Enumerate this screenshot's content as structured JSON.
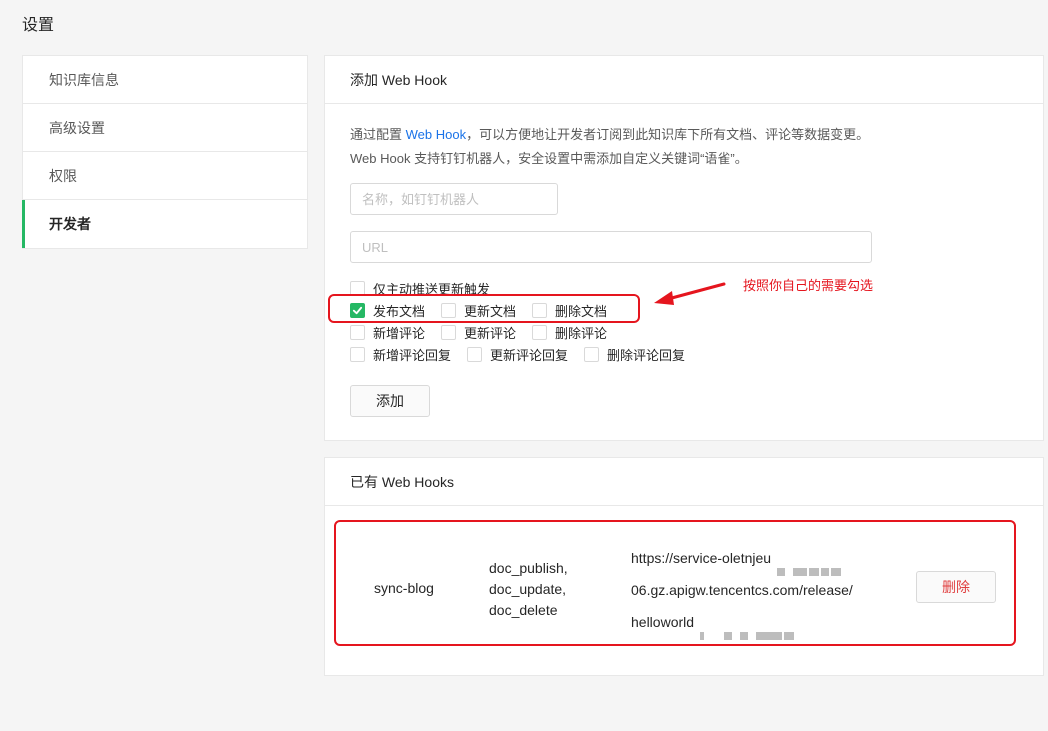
{
  "page": {
    "title": "设置"
  },
  "sidebar": {
    "items": [
      {
        "label": "知识库信息",
        "active": false
      },
      {
        "label": "高级设置",
        "active": false
      },
      {
        "label": "权限",
        "active": false
      },
      {
        "label": "开发者",
        "active": true
      }
    ]
  },
  "add_panel": {
    "title": "添加 Web Hook",
    "desc_prefix": "通过配置 ",
    "desc_link": "Web Hook",
    "desc_suffix": "，可以方便地让开发者订阅到此知识库下所有文档、评论等数据变更。Web Hook 支持钉钉机器人，安全设置中需添加自定义关键词“语雀”。",
    "name_placeholder": "名称，如钉钉机器人",
    "url_placeholder": "URL",
    "checkbox_rows": [
      [
        {
          "label": "仅主动推送更新触发",
          "checked": false
        }
      ],
      [
        {
          "label": "发布文档",
          "checked": true
        },
        {
          "label": "更新文档",
          "checked": false
        },
        {
          "label": "删除文档",
          "checked": false
        }
      ],
      [
        {
          "label": "新增评论",
          "checked": false
        },
        {
          "label": "更新评论",
          "checked": false
        },
        {
          "label": "删除评论",
          "checked": false
        }
      ],
      [
        {
          "label": "新增评论回复",
          "checked": false
        },
        {
          "label": "更新评论回复",
          "checked": false
        },
        {
          "label": "删除评论回复",
          "checked": false
        }
      ]
    ],
    "add_button": "添加"
  },
  "annotation": {
    "text": "按照你自己的需要勾选"
  },
  "hooks_panel": {
    "title": "已有 Web Hooks",
    "hooks": [
      {
        "name": "sync-blog",
        "events": [
          "doc_publish,",
          "doc_update,",
          "doc_delete"
        ],
        "url_lines": [
          "https://service-oletnjeu",
          "06.gz.apigw.tencentcs.com/release/",
          "helloworld"
        ],
        "delete_label": "删除"
      }
    ]
  },
  "colors": {
    "accent": "#25b864",
    "link": "#1a73e8",
    "danger": "#e03e3e",
    "annotation": "#e5151e"
  }
}
